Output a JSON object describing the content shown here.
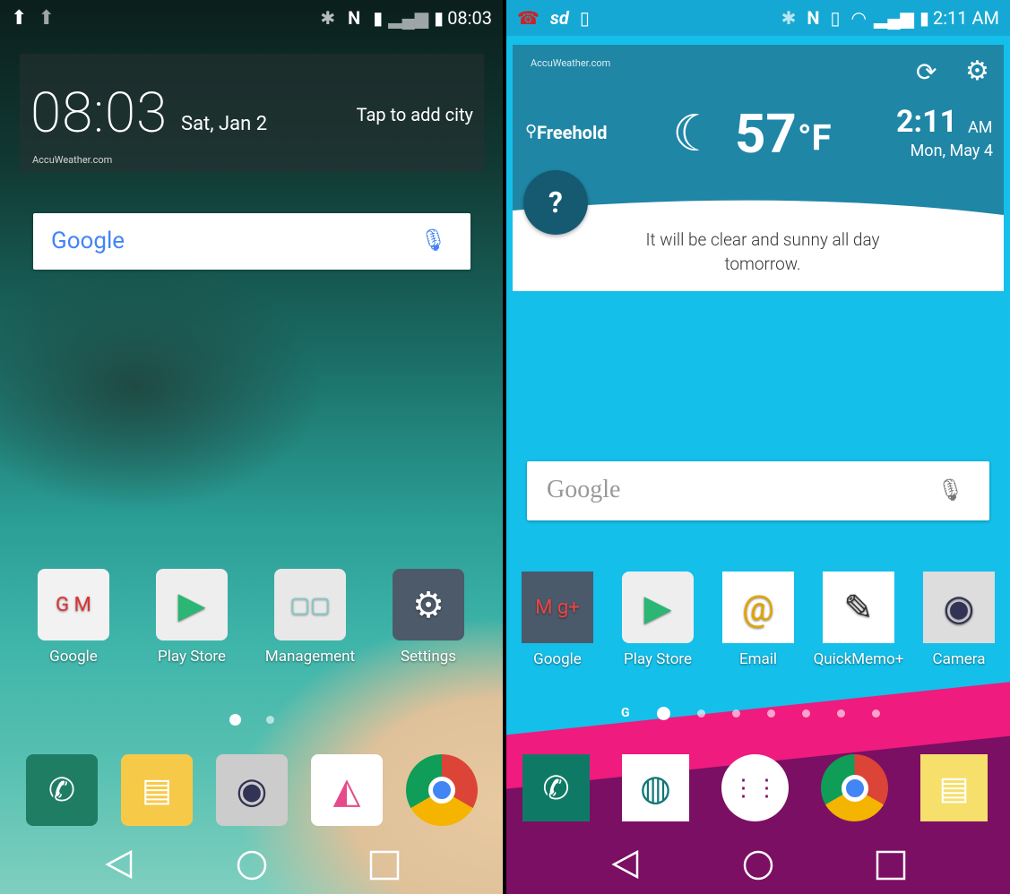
{
  "left": {
    "status": {
      "time": "08:03"
    },
    "clock_widget": {
      "time": "08:03",
      "date": "Sat, Jan 2",
      "add_city": "Tap to add city",
      "brand": "AccuWeather.com"
    },
    "search": {
      "logo": "Google",
      "mic_icon": "mic-icon"
    },
    "apps": [
      {
        "label": "Google",
        "icon": "google-folder-icon"
      },
      {
        "label": "Play Store",
        "icon": "play-store-icon"
      },
      {
        "label": "Management",
        "icon": "management-folder-icon"
      },
      {
        "label": "Settings",
        "icon": "gear-icon"
      }
    ],
    "page_indicator": {
      "count": 2,
      "active": 0
    },
    "dock": [
      "phone-icon",
      "messages-icon",
      "camera-icon",
      "gallery-icon",
      "chrome-icon"
    ]
  },
  "right": {
    "status": {
      "time": "2:11 AM"
    },
    "weather": {
      "brand": "AccuWeather.com",
      "location": "Freehold",
      "temp": "57",
      "unit": "°F",
      "time": "2:11",
      "ampm": "AM",
      "date": "Mon, May 4",
      "forecast": "It will be clear and sunny all day tomorrow.",
      "help": "?"
    },
    "search": {
      "logo": "Google"
    },
    "apps": [
      {
        "label": "Google"
      },
      {
        "label": "Play Store"
      },
      {
        "label": "Email"
      },
      {
        "label": "QuickMemo+"
      },
      {
        "label": "Camera"
      }
    ],
    "page_indicator": {
      "g_label": "G",
      "count": 7,
      "active": 0
    },
    "dock": [
      "phone-icon",
      "contacts-icon",
      "apps-drawer-icon",
      "chrome-icon",
      "messages-icon"
    ]
  },
  "colors": {
    "right_bg": "#14bfea",
    "weather_card": "#1f86a6",
    "purple_dock": "#7b0f63",
    "pink_band": "#ef1b7e"
  }
}
